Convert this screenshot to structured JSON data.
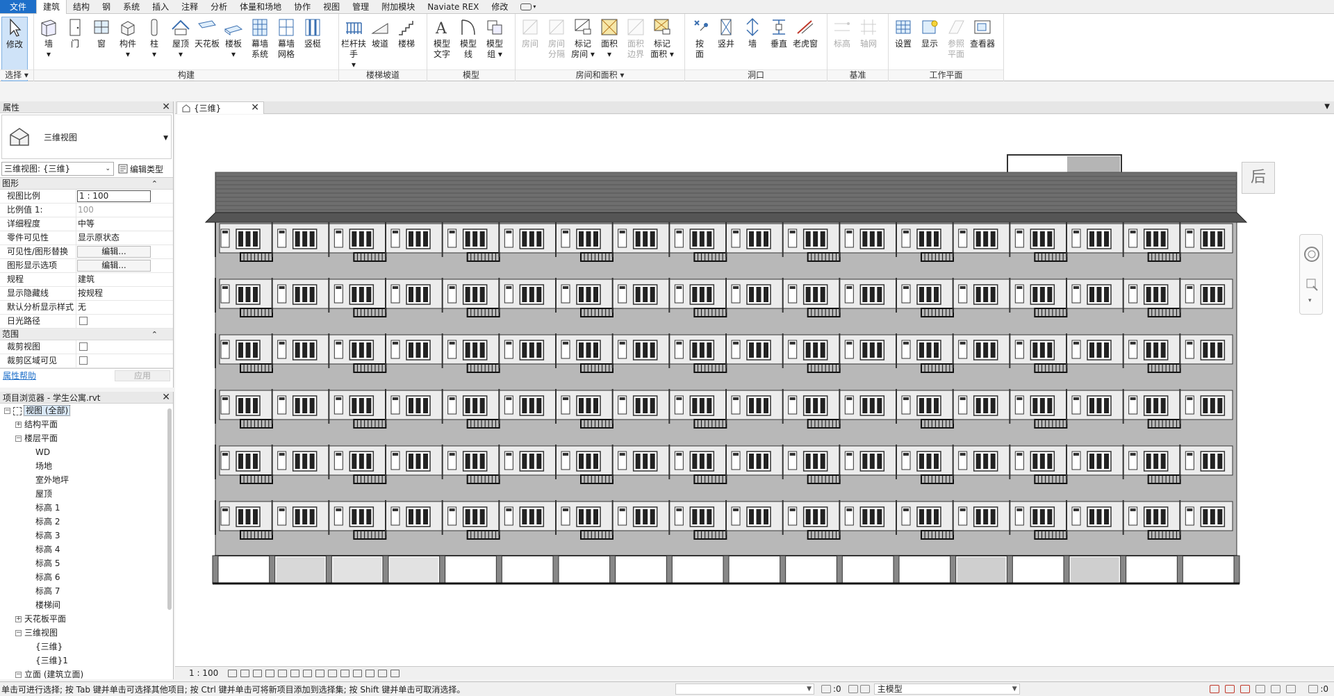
{
  "ribbon_tabs": [
    "文件",
    "建筑",
    "结构",
    "钢",
    "系统",
    "插入",
    "注释",
    "分析",
    "体量和场地",
    "协作",
    "视图",
    "管理",
    "附加模块",
    "Naviate REX",
    "修改"
  ],
  "ribbon_active_tab": "建筑",
  "panels": [
    {
      "label": "选择 ▾",
      "buttons": [
        {
          "label": "修改",
          "icon": "cursor-icon",
          "sel": true
        }
      ]
    },
    {
      "label": "构建",
      "buttons": [
        {
          "label": "墙\n▾",
          "icon": "wall-icon"
        },
        {
          "label": "门",
          "icon": "door-icon"
        },
        {
          "label": "窗",
          "icon": "window-icon"
        },
        {
          "label": "构件\n▾",
          "icon": "component-icon"
        },
        {
          "label": "柱\n▾",
          "icon": "column-icon"
        },
        {
          "label": "屋顶\n▾",
          "icon": "roof-icon"
        },
        {
          "label": "天花板",
          "icon": "ceiling-icon"
        },
        {
          "label": "楼板\n▾",
          "icon": "floor-icon"
        },
        {
          "label": "幕墙\n系统",
          "icon": "curtain-system-icon"
        },
        {
          "label": "幕墙\n网格",
          "icon": "curtain-grid-icon"
        },
        {
          "label": "竖梃",
          "icon": "mullion-icon"
        }
      ]
    },
    {
      "label": "楼梯坡道",
      "buttons": [
        {
          "label": "栏杆扶手\n▾",
          "icon": "railing-icon"
        },
        {
          "label": "坡道",
          "icon": "ramp-icon"
        },
        {
          "label": "楼梯",
          "icon": "stair-icon"
        }
      ]
    },
    {
      "label": "模型",
      "buttons": [
        {
          "label": "模型\n文字",
          "icon": "model-text-icon"
        },
        {
          "label": "模型\n线",
          "icon": "model-line-icon"
        },
        {
          "label": "模型\n组 ▾",
          "icon": "model-group-icon"
        }
      ]
    },
    {
      "label": "房间和面积 ▾",
      "buttons": [
        {
          "label": "房间",
          "icon": "room-icon",
          "dis": true
        },
        {
          "label": "房间\n分隔",
          "icon": "room-separator-icon",
          "dis": true
        },
        {
          "label": "标记\n房间 ▾",
          "icon": "tag-room-icon"
        },
        {
          "label": "面积\n▾",
          "icon": "area-icon"
        },
        {
          "label": "面积\n边界",
          "icon": "area-boundary-icon",
          "dis": true
        },
        {
          "label": "标记\n面积 ▾",
          "icon": "tag-area-icon"
        }
      ]
    },
    {
      "label": "洞口",
      "buttons": [
        {
          "label": "按\n面",
          "icon": "by-face-icon"
        },
        {
          "label": "竖井",
          "icon": "shaft-icon"
        },
        {
          "label": "墙",
          "icon": "wall-opening-icon"
        },
        {
          "label": "垂直",
          "icon": "vertical-icon"
        },
        {
          "label": "老虎窗",
          "icon": "dormer-icon"
        }
      ]
    },
    {
      "label": "基准",
      "buttons": [
        {
          "label": "标高",
          "icon": "level-icon",
          "dis": true
        },
        {
          "label": "轴网",
          "icon": "grid-icon",
          "dis": true
        }
      ]
    },
    {
      "label": "工作平面",
      "buttons": [
        {
          "label": "设置",
          "icon": "set-icon"
        },
        {
          "label": "显示",
          "icon": "show-icon"
        },
        {
          "label": "参照\n平面",
          "icon": "ref-plane-icon",
          "dis": true
        },
        {
          "label": "查看器",
          "icon": "viewer-icon"
        }
      ]
    }
  ],
  "properties": {
    "title": "属性",
    "type_name": "三维视图",
    "instance_selector": "三维视图: {三维}",
    "edit_type": "编辑类型",
    "groups": [
      {
        "name": "图形",
        "rows": [
          {
            "k": "视图比例",
            "v": "1 : 100",
            "kind": "field"
          },
          {
            "k": "比例值 1:",
            "v": "100",
            "kind": "gray"
          },
          {
            "k": "详细程度",
            "v": "中等",
            "kind": "text"
          },
          {
            "k": "零件可见性",
            "v": "显示原状态",
            "kind": "text"
          },
          {
            "k": "可见性/图形替换",
            "v": "编辑...",
            "kind": "button"
          },
          {
            "k": "图形显示选项",
            "v": "编辑...",
            "kind": "button"
          },
          {
            "k": "规程",
            "v": "建筑",
            "kind": "text"
          },
          {
            "k": "显示隐藏线",
            "v": "按规程",
            "kind": "text"
          },
          {
            "k": "默认分析显示样式",
            "v": "无",
            "kind": "text"
          },
          {
            "k": "日光路径",
            "v": "",
            "kind": "check"
          }
        ]
      },
      {
        "name": "范围",
        "rows": [
          {
            "k": "裁剪视图",
            "v": "",
            "kind": "check"
          },
          {
            "k": "裁剪区域可见",
            "v": "",
            "kind": "check"
          }
        ]
      }
    ],
    "help_link": "属性帮助",
    "apply": "应用"
  },
  "browser": {
    "title": "项目浏览器 - 学生公寓.rvt",
    "nodes": [
      {
        "t": "视图 (全部)",
        "lvl": 0,
        "tg": "−",
        "sel": true
      },
      {
        "t": "结构平面",
        "lvl": 1,
        "tg": "+"
      },
      {
        "t": "楼层平面",
        "lvl": 1,
        "tg": "−"
      },
      {
        "t": "WD",
        "lvl": 2
      },
      {
        "t": "场地",
        "lvl": 2
      },
      {
        "t": "室外地坪",
        "lvl": 2
      },
      {
        "t": "屋顶",
        "lvl": 2
      },
      {
        "t": "标高 1",
        "lvl": 2
      },
      {
        "t": "标高 2",
        "lvl": 2
      },
      {
        "t": "标高 3",
        "lvl": 2
      },
      {
        "t": "标高 4",
        "lvl": 2
      },
      {
        "t": "标高 5",
        "lvl": 2
      },
      {
        "t": "标高 6",
        "lvl": 2
      },
      {
        "t": "标高 7",
        "lvl": 2
      },
      {
        "t": "楼梯间",
        "lvl": 2
      },
      {
        "t": "天花板平面",
        "lvl": 1,
        "tg": "+"
      },
      {
        "t": "三维视图",
        "lvl": 1,
        "tg": "−"
      },
      {
        "t": "{三维}",
        "lvl": 2
      },
      {
        "t": "{三维}1",
        "lvl": 2
      },
      {
        "t": "立面 (建筑立面)",
        "lvl": 1,
        "tg": "−"
      }
    ]
  },
  "view": {
    "tab_label": "{三维}",
    "viewcube_face": "后",
    "scale": "1 : 100",
    "floors": 6,
    "bays": 18
  },
  "status": {
    "message": "单击可进行选择; 按 Tab 键并单击可选择其他项目; 按 Ctrl 键并单击可将新项目添加到选择集; 按 Shift 键并单击可取消选择。",
    "count": ":0",
    "model": "主模型",
    "filter_count": ":0"
  }
}
